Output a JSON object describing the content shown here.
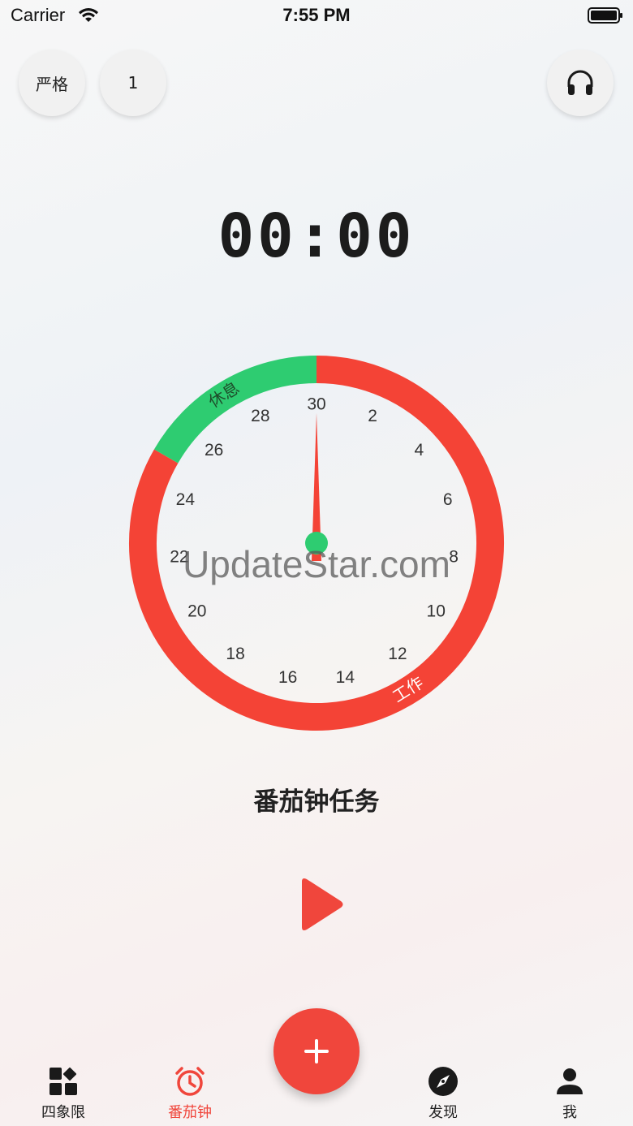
{
  "status_bar": {
    "carrier": "Carrier",
    "time": "7:55 PM"
  },
  "header": {
    "mode_label": "严格",
    "count_label": "1",
    "sound_icon": "headphones-icon"
  },
  "timer": {
    "display": "00:00"
  },
  "clock": {
    "total_minutes": 30,
    "tick_labels": [
      "30",
      "2",
      "4",
      "6",
      "8",
      "10",
      "12",
      "14",
      "16",
      "18",
      "20",
      "22",
      "24",
      "26",
      "28"
    ],
    "work_label": "工作",
    "rest_label": "休息",
    "work_color": "#f44336",
    "rest_color": "#2ecc71"
  },
  "watermark": "UpdateStar.com",
  "task": {
    "title": "番茄钟任务"
  },
  "controls": {
    "play_icon": "play-icon",
    "play_color": "#f0463c"
  },
  "tabbar": {
    "items": [
      {
        "label": "四象限",
        "icon": "quadrant-grid-icon"
      },
      {
        "label": "番茄钟",
        "icon": "alarm-clock-icon",
        "active": true
      },
      {
        "label": "发现",
        "icon": "compass-icon"
      },
      {
        "label": "我",
        "icon": "person-icon"
      }
    ],
    "fab_icon": "plus-icon",
    "accent": "#f0463c"
  }
}
